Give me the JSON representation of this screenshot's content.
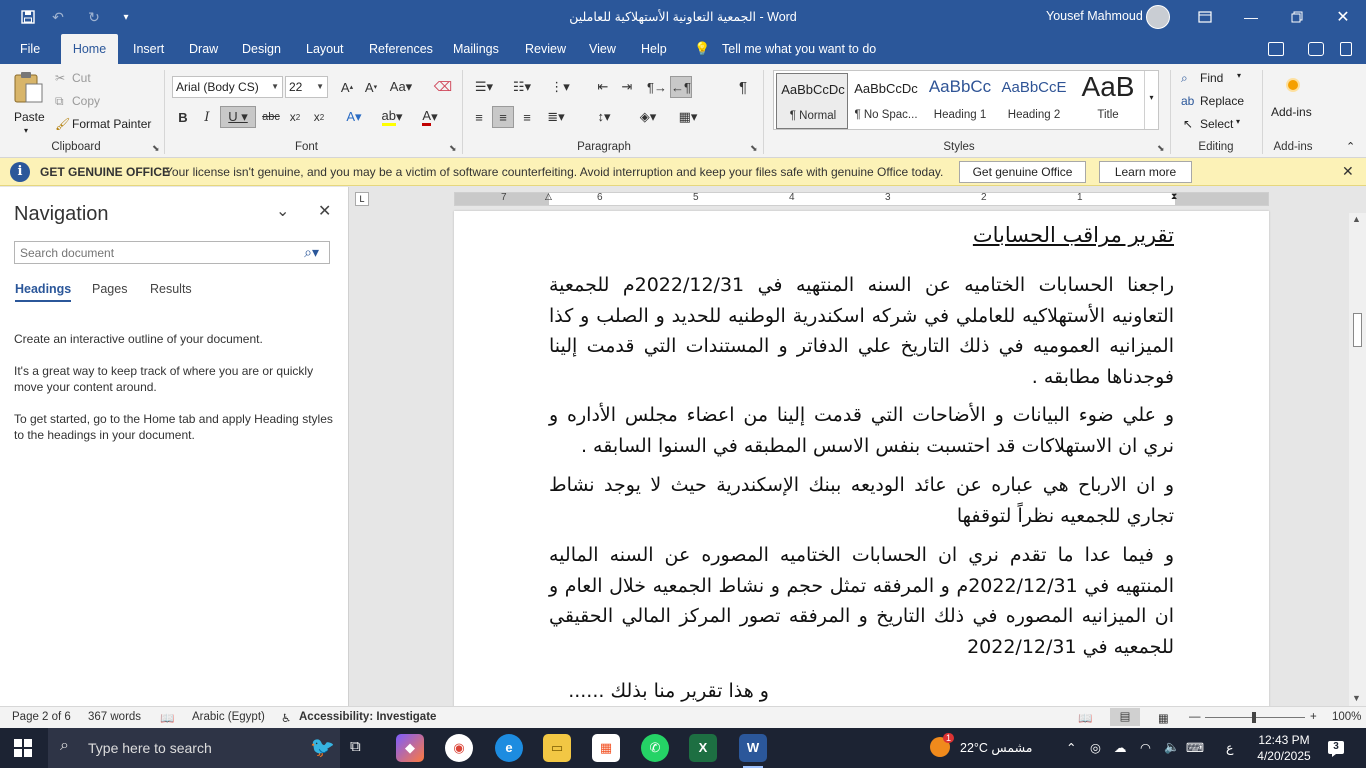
{
  "titlebar": {
    "title": "الجمعية التعاونية الأستهلاكية للعاملين  -  Word",
    "user": "Yousef Mahmoud"
  },
  "tabs": [
    "File",
    "Home",
    "Insert",
    "Draw",
    "Design",
    "Layout",
    "References",
    "Mailings",
    "Review",
    "View",
    "Help"
  ],
  "active_tab": "Home",
  "tell_me": "Tell me what you want to do",
  "ribbon": {
    "clipboard": {
      "label": "Clipboard",
      "paste": "Paste",
      "cut": "Cut",
      "copy": "Copy",
      "format_painter": "Format Painter"
    },
    "font": {
      "label": "Font",
      "font_name": "Arial (Body CS)",
      "font_size": "22"
    },
    "paragraph": {
      "label": "Paragraph"
    },
    "styles": {
      "label": "Styles",
      "items": [
        {
          "sample": "AaBbCcDc",
          "name": "¶ Normal"
        },
        {
          "sample": "AaBbCcDc",
          "name": "¶ No Spac..."
        },
        {
          "sample": "AaBbCc",
          "name": "Heading 1"
        },
        {
          "sample": "AaBbCcE",
          "name": "Heading 2"
        },
        {
          "sample": "AaB",
          "name": "Title"
        }
      ]
    },
    "editing": {
      "label": "Editing",
      "find": "Find",
      "replace": "Replace",
      "select": "Select"
    },
    "addins": {
      "label": "Add-ins",
      "button": "Add-ins"
    }
  },
  "message_bar": {
    "heading": "GET GENUINE OFFICE",
    "text": "Your license isn't genuine, and you may be a victim of software counterfeiting. Avoid interruption and keep your files safe with genuine Office today.",
    "primary_button": "Get genuine Office",
    "secondary_button": "Learn more"
  },
  "navigation": {
    "title": "Navigation",
    "search_placeholder": "Search document",
    "tabs": [
      "Headings",
      "Pages",
      "Results"
    ],
    "active_tab": "Headings",
    "paragraphs": [
      "Create an interactive outline of your document.",
      "It's a great way to keep track of where you are or quickly move your content around.",
      "To get started, go to the Home tab and apply Heading styles to the headings in your document."
    ]
  },
  "ruler": {
    "numbers": [
      "7",
      "6",
      "5",
      "4",
      "3",
      "2",
      "1"
    ]
  },
  "document": {
    "heading": "تقرير مراقب الحسابات",
    "paragraphs": [
      "راجعنا الحسابات الختاميه عن السنه المنتهيه في 2022/12/31م للجمعية التعاونيه الأستهلاكيه للعاملي في شركه اسكندرية الوطنيه للحديد و الصلب و كذا الميزانيه العموميه في ذلك التاريخ علي الدفاتر و المستندات التي قدمت إلينا فوجدناها مطابقه .",
      "و علي ضوء البيانات و الأضاحات التي قدمت إلينا من اعضاء مجلس الأداره و نري ان الاستهلاكات قد احتسبت بنفس الاسس المطبقه في السنوا السابقه .",
      "و ان الارباح هي عباره عن عائد الوديعه ببنك الإسكندرية حيث لا يوجد نشاط تجاري للجمعيه نظراً لتوقفها",
      "و فيما عدا ما تقدم نري ان الحسابات الختاميه المصوره عن السنه الماليه المنتهيه في 2022/12/31م و المرفقه تمثل حجم و نشاط الجمعيه خلال العام و ان الميزانيه المصوره في ذلك التاريخ و المرفقه تصور المركز المالي الحقيقي للجمعيه في 2022/12/31",
      "و هذا تقرير منا بذلك ......"
    ]
  },
  "status_bar": {
    "page": "Page 2 of 6",
    "words": "367 words",
    "language": "Arabic (Egypt)",
    "accessibility": "Accessibility: Investigate",
    "zoom": "100%"
  },
  "taskbar": {
    "search_placeholder": "Type here to search",
    "weather": "22°C  مشمس",
    "input_language": "ع",
    "time": "12:43 PM",
    "date": "4/20/2025",
    "notifications": "3",
    "weather_badge": "1"
  },
  "colors": {
    "word_blue": "#2b579a",
    "message_bar": "#fcf2b7",
    "taskbar": "#1c2333"
  }
}
